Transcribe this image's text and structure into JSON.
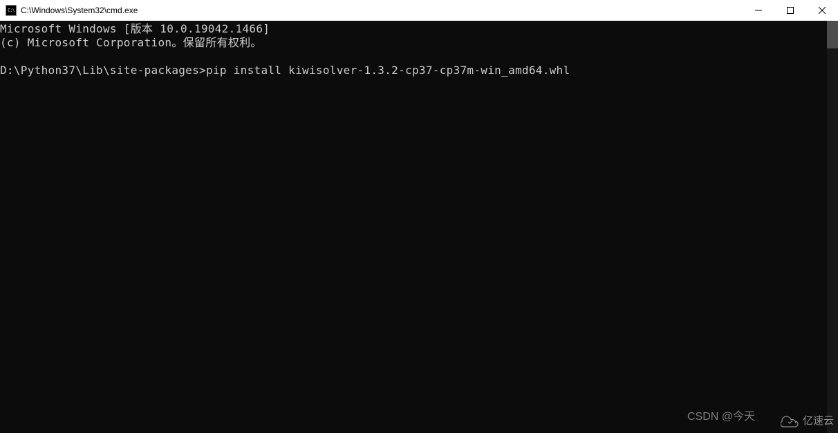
{
  "titlebar": {
    "icon_label": "C:\\",
    "title": "C:\\Windows\\System32\\cmd.exe"
  },
  "terminal": {
    "line1": "Microsoft Windows [版本 10.0.19042.1466]",
    "line2": "(c) Microsoft Corporation。保留所有权利。",
    "line3": "",
    "prompt": "D:\\Python37\\Lib\\site-packages>",
    "command": "pip install kiwisolver-1.3.2-cp37-cp37m-win_amd64.whl"
  },
  "watermarks": {
    "csdn": "CSDN @今天",
    "cloud": "亿速云"
  }
}
